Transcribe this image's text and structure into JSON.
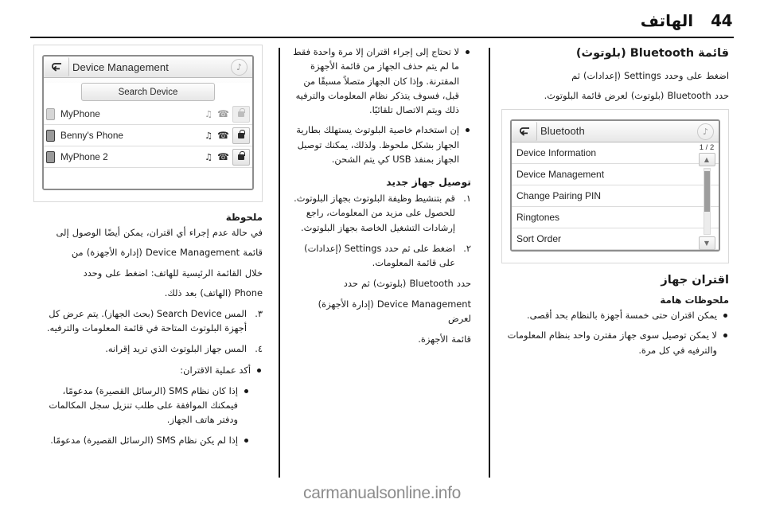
{
  "header": {
    "page_number": "44",
    "title": "الهاتف"
  },
  "footer": {
    "watermark": "carmanualsonline.info"
  },
  "column_right": {
    "section_title": "قائمة Bluetooth (بلوتوث)",
    "intro_line_1": "اضغط على  وحدد Settings (إعدادات) ثم",
    "intro_line_2": "حدد Bluetooth (بلوتوث) لعرض قائمة البلوتوث.",
    "screenshot": {
      "title": "Bluetooth",
      "back_icon": "back-arrow-icon",
      "note_icon": "music-note-icon",
      "page_indicator": "1 / 2",
      "scroll_up_icon": "chevron-up-icon",
      "scroll_down_icon": "chevron-down-icon",
      "items": [
        "Device Information",
        "Device Management",
        "Change Pairing PIN",
        "Ringtones",
        "Sort Order"
      ]
    },
    "pairing_title": "اقتران جهاز",
    "pairing_note_head": "ملحوظات هامة",
    "pairing_bullets": [
      "يمكن اقتران حتى خمسة أجهزة بالنظام بحد أقصى.",
      "لا يمكن توصيل سوى جهاز مقترن واحد بنظام المعلومات والترفيه في كل مرة."
    ]
  },
  "column_mid": {
    "bullets": [
      "لا تحتاج إلى إجراء اقتران إلا مرة واحدة فقط ما لم يتم حذف الجهاز من قائمة الأجهزة المقترنة. وإذا كان الجهاز متصلاً مسبقًا من قبل، فسوف يتذكر نظام المعلومات والترفيه ذلك ويتم الاتصال تلقائيًا.",
      "إن استخدام خاصية البلوتوث يستهلك بطارية الجهاز بشكل ملحوظ. ولذلك، يمكنك توصيل الجهاز بمنفذ USB كي يتم الشحن."
    ],
    "new_device_title": "توصيل جهاز جديد",
    "steps": [
      {
        "num": "١.",
        "text": "قم بتنشيط وظيفة البلوتوث بجهاز البلوتوث. للحصول على مزيد من المعلومات، راجع إرشادات التشغيل الخاصة بجهاز البلوتوث."
      },
      {
        "num": "٢.",
        "text": "اضغط على  ثم حدد Settings (إعدادات) على قائمة المعلومات."
      }
    ],
    "after_steps_line_1": "حدد Bluetooth (بلوتوث) ثم حدد",
    "after_steps_line_2": "Device Management (إدارة الأجهزة) لعرض",
    "after_steps_line_3": "قائمة الأجهزة."
  },
  "column_left": {
    "screenshot": {
      "title": "Device Management",
      "back_icon": "back-arrow-icon",
      "note_icon": "music-note-icon",
      "search_button": "Search Device",
      "bluetooth_icon": "bluetooth-icon",
      "call_icon": "phone-handset-icon",
      "lock_icon": "lock-icon",
      "devices": [
        {
          "name": "MyPhone",
          "state": "dim"
        },
        {
          "name": "Benny's Phone",
          "state": "active"
        },
        {
          "name": "MyPhone 2",
          "state": "active"
        }
      ]
    },
    "note_head": "ملحوظة",
    "note_body_line_1": "في حالة عدم إجراء أي اقتران، يمكن أيضًا الوصول إلى",
    "note_body_line_2": "قائمة Device Management (إدارة الأجهزة) من",
    "note_body_line_3": "خلال القائمة الرئيسية للهاتف: اضغط على  وحدد",
    "note_body_line_4": "Phone (الهاتف) بعد ذلك.",
    "steps": [
      {
        "num": "٣.",
        "text": "المس Search Device (بحث الجهاز). يتم عرض كل أجهزة البلوتوث المتاحة في قائمة المعلومات والترفيه."
      },
      {
        "num": "٤.",
        "text": "المس جهاز البلوتوث الذي تريد إقرانه."
      }
    ],
    "confirm_lead": "أكد عملية الاقتران:",
    "confirm_bullets": [
      "إذا كان نظام SMS (الرسائل القصيرة) مدعومًا، فيمكنك الموافقة على طلب تنزيل سجل المكالمات ودفتر هاتف الجهاز.",
      "إذا لم يكن نظام SMS (الرسائل القصيرة) مدعومًا."
    ]
  }
}
